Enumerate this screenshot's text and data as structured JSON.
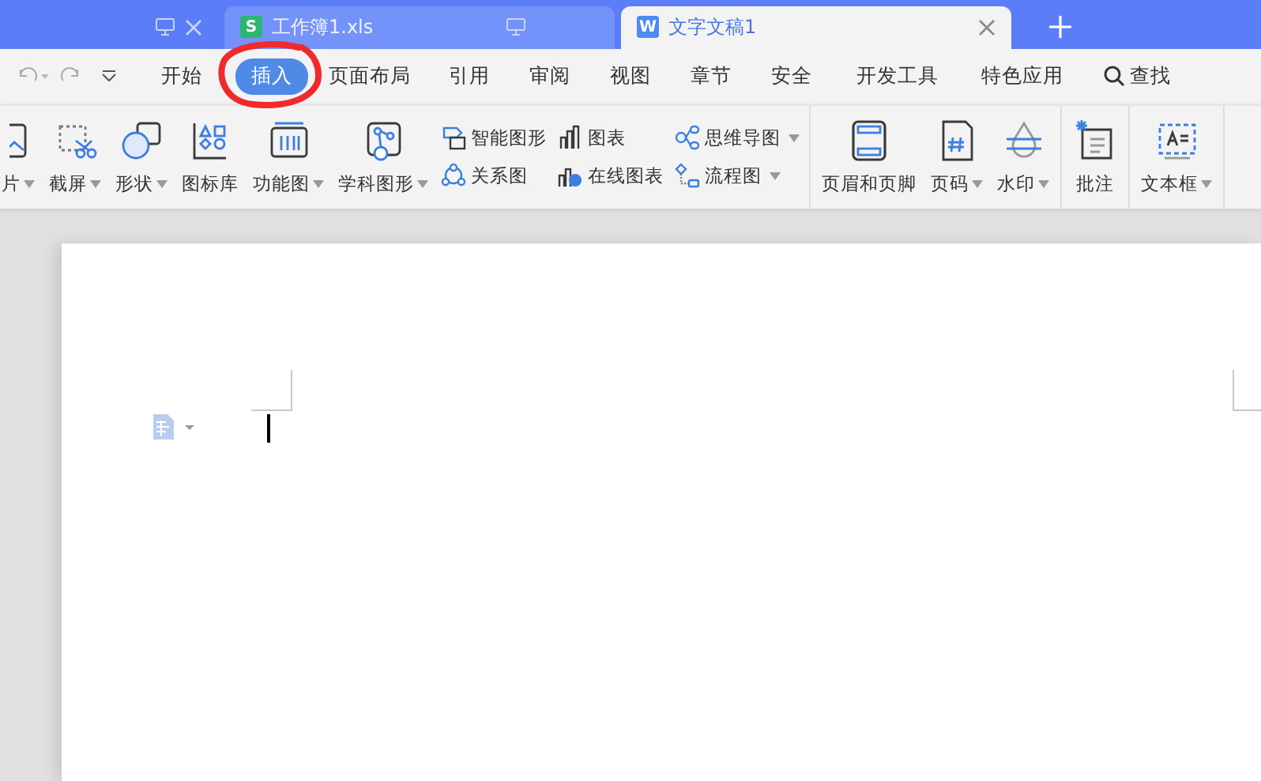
{
  "tabs": [
    {
      "kind": "blank",
      "selected": false
    },
    {
      "kind": "sheet",
      "badge": "S",
      "title": "工作簿1.xls",
      "selected": false
    },
    {
      "kind": "writer",
      "badge": "W",
      "title": "文字文稿1",
      "selected": true
    }
  ],
  "menu": [
    {
      "label": "开始",
      "selected": false,
      "circled": false
    },
    {
      "label": "插入",
      "selected": true,
      "circled": true
    },
    {
      "label": "页面布局",
      "selected": false,
      "circled": false
    },
    {
      "label": "引用",
      "selected": false,
      "circled": false
    },
    {
      "label": "审阅",
      "selected": false,
      "circled": false
    },
    {
      "label": "视图",
      "selected": false,
      "circled": false
    },
    {
      "label": "章节",
      "selected": false,
      "circled": false
    },
    {
      "label": "安全",
      "selected": false,
      "circled": false
    },
    {
      "label": "开发工具",
      "selected": false,
      "circled": false
    },
    {
      "label": "特色应用",
      "selected": false,
      "circled": false
    }
  ],
  "search": {
    "label": "查找"
  },
  "ribbon": [
    [
      {
        "kind": "large",
        "label": "片",
        "dropdown": true
      },
      {
        "kind": "large",
        "label": "截屏",
        "dropdown": true
      },
      {
        "kind": "large",
        "label": "形状",
        "dropdown": true
      },
      {
        "kind": "large",
        "label": "图标库",
        "dropdown": false
      },
      {
        "kind": "large",
        "label": "功能图",
        "dropdown": true
      },
      {
        "kind": "large",
        "label": "学科图形",
        "dropdown": true
      },
      {
        "kind": "stack",
        "items": [
          {
            "label": "智能图形",
            "dropdown": false
          },
          {
            "label": "关系图",
            "dropdown": false
          }
        ]
      },
      {
        "kind": "stack",
        "items": [
          {
            "label": "图表",
            "dropdown": false
          },
          {
            "label": "在线图表",
            "dropdown": false
          }
        ]
      },
      {
        "kind": "stack",
        "items": [
          {
            "label": "思维导图",
            "dropdown": true
          },
          {
            "label": "流程图",
            "dropdown": true
          }
        ]
      }
    ],
    [
      {
        "kind": "large",
        "label": "页眉和页脚",
        "dropdown": false
      },
      {
        "kind": "large",
        "label": "页码",
        "dropdown": true
      },
      {
        "kind": "large",
        "label": "水印",
        "dropdown": true
      }
    ],
    [
      {
        "kind": "large",
        "label": "批注",
        "dropdown": false
      }
    ],
    [
      {
        "kind": "large",
        "label": "文本框",
        "dropdown": true
      }
    ]
  ]
}
